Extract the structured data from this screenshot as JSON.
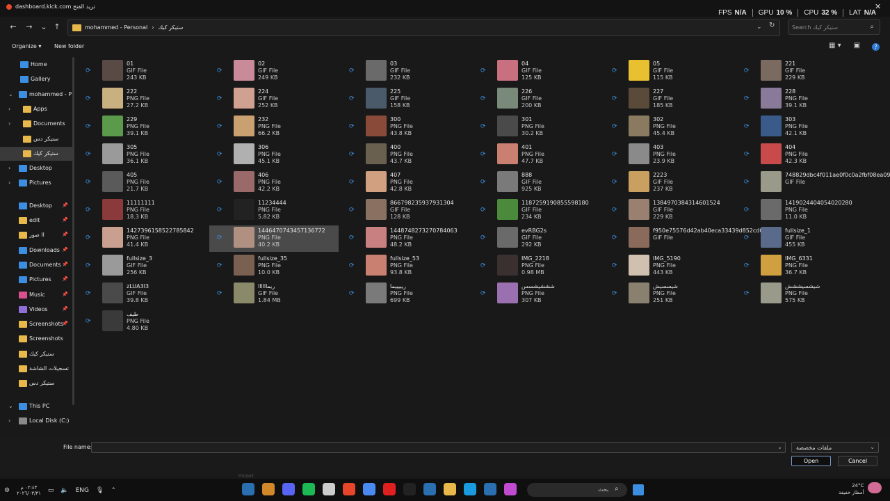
{
  "window": {
    "title": "dashboard.kick.com تريد الفتح",
    "close": "✕"
  },
  "overlay": {
    "items": [
      {
        "label": "FPS",
        "value": "N/A"
      },
      {
        "label": "GPU",
        "value": "10 %"
      },
      {
        "label": "CPU",
        "value": "32 %"
      },
      {
        "label": "LAT",
        "value": "N/A"
      }
    ]
  },
  "nav": {
    "back": "←",
    "forward": "→",
    "recent": "⌄",
    "up": "↑",
    "path": [
      "mohammed - Personal",
      "›",
      "ستيكر كيك"
    ],
    "refresh": "↻",
    "search_placeholder": "Search ستيكر كيك",
    "search_icon": "search-icon"
  },
  "commandbar": {
    "organize": "Organize ▾",
    "new_folder": "New folder",
    "help": "?"
  },
  "sidebar": {
    "items": [
      {
        "label": "Home",
        "icon": "home-icon",
        "color": "#3c8fe0",
        "chev": false,
        "pin": false
      },
      {
        "label": "Gallery",
        "icon": "gallery-icon",
        "color": "#3c8fe0",
        "chev": false,
        "pin": false
      },
      {
        "label": "mohammed - P",
        "icon": "cloud-icon",
        "color": "#3c8fe0",
        "chev": true,
        "open": true,
        "pin": false
      },
      {
        "label": "Apps",
        "icon": "folder-icon",
        "color": "#e8b84a",
        "chev": true,
        "pin": false
      },
      {
        "label": "Documents",
        "icon": "folder-icon",
        "color": "#e8b84a",
        "chev": true,
        "pin": false
      },
      {
        "label": "ستيكر دس",
        "icon": "folder-icon",
        "color": "#e8b84a",
        "chev": false,
        "pin": false
      },
      {
        "label": "ستيكر كيك",
        "icon": "folder-icon",
        "color": "#e8b84a",
        "chev": false,
        "pin": false,
        "selected": true
      },
      {
        "label": "Desktop",
        "icon": "desktop-icon",
        "color": "#3c8fe0",
        "chev": true,
        "pin": false
      },
      {
        "label": "Pictures",
        "icon": "pictures-icon",
        "color": "#3c8fe0",
        "chev": true,
        "pin": false
      },
      {
        "label": "Desktop",
        "icon": "desktop-icon",
        "color": "#3c8fe0",
        "chev": false,
        "pin": true,
        "gap": true
      },
      {
        "label": "edit",
        "icon": "folder-icon",
        "color": "#e8b84a",
        "chev": false,
        "pin": true
      },
      {
        "label": "صور ll",
        "icon": "folder-icon",
        "color": "#e8b84a",
        "chev": false,
        "pin": true
      },
      {
        "label": "Downloads",
        "icon": "download-icon",
        "color": "#3c8fe0",
        "chev": false,
        "pin": true
      },
      {
        "label": "Documents",
        "icon": "documents-icon",
        "color": "#3c8fe0",
        "chev": false,
        "pin": true
      },
      {
        "label": "Pictures",
        "icon": "pictures-icon",
        "color": "#3c8fe0",
        "chev": false,
        "pin": true
      },
      {
        "label": "Music",
        "icon": "music-icon",
        "color": "#d8508e",
        "chev": false,
        "pin": true
      },
      {
        "label": "Videos",
        "icon": "videos-icon",
        "color": "#8e6fd8",
        "chev": false,
        "pin": true
      },
      {
        "label": "Screenshots",
        "icon": "folder-icon",
        "color": "#e8b84a",
        "chev": false,
        "pin": true
      },
      {
        "label": "Screenshots",
        "icon": "folder-icon",
        "color": "#e8b84a",
        "chev": false,
        "pin": false
      },
      {
        "label": "ستيكر كيك",
        "icon": "folder-icon",
        "color": "#e8b84a",
        "chev": false,
        "pin": false
      },
      {
        "label": "تسجيلات الشاشة",
        "icon": "folder-icon",
        "color": "#e8b84a",
        "chev": false,
        "pin": false
      },
      {
        "label": "ستيكر دس",
        "icon": "folder-icon",
        "color": "#e8b84a",
        "chev": false,
        "pin": false
      },
      {
        "label": "This PC",
        "icon": "pc-icon",
        "color": "#3c8fe0",
        "chev": true,
        "open": true,
        "pin": false,
        "gap": true
      },
      {
        "label": "Local Disk (C:)",
        "icon": "drive-icon",
        "color": "#8a8a8a",
        "chev": true,
        "pin": false
      }
    ]
  },
  "files": [
    {
      "name": "01",
      "type": "GIF File",
      "size": "243 KB",
      "color": "#5a4a45"
    },
    {
      "name": "02",
      "type": "GIF File",
      "size": "249 KB",
      "color": "#c98a9a"
    },
    {
      "name": "03",
      "type": "GIF File",
      "size": "232 KB",
      "color": "#6a6a6a"
    },
    {
      "name": "04",
      "type": "GIF File",
      "size": "125 KB",
      "color": "#c97080"
    },
    {
      "name": "05",
      "type": "GIF File",
      "size": "115 KB",
      "color": "#e8c030"
    },
    {
      "name": "221",
      "type": "GIF File",
      "size": "229 KB",
      "color": "#7a6a60"
    },
    {
      "name": "222",
      "type": "PNG File",
      "size": "27.2 KB",
      "color": "#c9b080"
    },
    {
      "name": "224",
      "type": "GIF File",
      "size": "252 KB",
      "color": "#d0a090"
    },
    {
      "name": "225",
      "type": "GIF File",
      "size": "158 KB",
      "color": "#4a5a6a"
    },
    {
      "name": "226",
      "type": "GIF File",
      "size": "200 KB",
      "color": "#7a8a7a"
    },
    {
      "name": "227",
      "type": "GIF File",
      "size": "185 KB",
      "color": "#5a4a3a"
    },
    {
      "name": "228",
      "type": "PNG File",
      "size": "39.1 KB",
      "color": "#8a7a9a"
    },
    {
      "name": "229",
      "type": "PNG File",
      "size": "39.1 KB",
      "color": "#5a9a4a"
    },
    {
      "name": "232",
      "type": "PNG File",
      "size": "66.2 KB",
      "color": "#c9a070"
    },
    {
      "name": "300",
      "type": "PNG File",
      "size": "43.8 KB",
      "color": "#8a4a3a"
    },
    {
      "name": "301",
      "type": "PNG File",
      "size": "30.2 KB",
      "color": "#4a4a4a"
    },
    {
      "name": "302",
      "type": "PNG File",
      "size": "45.4 KB",
      "color": "#8a7a60"
    },
    {
      "name": "303",
      "type": "PNG File",
      "size": "42.1 KB",
      "color": "#3a5a8a"
    },
    {
      "name": "305",
      "type": "PNG File",
      "size": "36.1 KB",
      "color": "#9a9a9a"
    },
    {
      "name": "306",
      "type": "PNG File",
      "size": "45.1 KB",
      "color": "#b0b0b0"
    },
    {
      "name": "400",
      "type": "PNG File",
      "size": "43.7 KB",
      "color": "#6a6050"
    },
    {
      "name": "401",
      "type": "PNG File",
      "size": "47.7 KB",
      "color": "#c98070"
    },
    {
      "name": "403",
      "type": "PNG File",
      "size": "23.9 KB",
      "color": "#8a8a8a"
    },
    {
      "name": "404",
      "type": "PNG File",
      "size": "42.3 KB",
      "color": "#c94a4a"
    },
    {
      "name": "405",
      "type": "PNG File",
      "size": "21.7 KB",
      "color": "#5a5a5a"
    },
    {
      "name": "406",
      "type": "PNG File",
      "size": "42.2 KB",
      "color": "#9a6a6a"
    },
    {
      "name": "407",
      "type": "PNG File",
      "size": "42.8 KB",
      "color": "#d0a080"
    },
    {
      "name": "888",
      "type": "GIF File",
      "size": "925 KB",
      "color": "#7a7a7a"
    },
    {
      "name": "2223",
      "type": "GIF File",
      "size": "237 KB",
      "color": "#c9a060"
    },
    {
      "name": "748829dbc4f011ae0f0c0a2fbf08ea09",
      "type": "GIF File",
      "size": "",
      "color": "#9a9a8a"
    },
    {
      "name": "11111111",
      "type": "PNG File",
      "size": "18.3 KB",
      "color": "#8a3a3a"
    },
    {
      "name": "11234444",
      "type": "PNG File",
      "size": "5.82 KB",
      "color": "#222222"
    },
    {
      "name": "866798235937931304",
      "type": "GIF File",
      "size": "128 KB",
      "color": "#8a7060"
    },
    {
      "name": "1187259190855598180",
      "type": "GIF File",
      "size": "234 KB",
      "color": "#4a8a3a"
    },
    {
      "name": "1384970384314601524",
      "type": "GIF File",
      "size": "229 KB",
      "color": "#9a8070"
    },
    {
      "name": "1419024404054020280",
      "type": "PNG File",
      "size": "11.0 KB",
      "color": "#6a6a6a"
    },
    {
      "name": "1427396158522785842",
      "type": "PNG File",
      "size": "41.4 KB",
      "color": "#c9a090"
    },
    {
      "name": "1446470743457136772",
      "type": "PNG File",
      "size": "40.2 KB",
      "color": "#b09080",
      "selected": true
    },
    {
      "name": "1448748273270784063",
      "type": "PNG File",
      "size": "48.2 KB",
      "color": "#c98080"
    },
    {
      "name": "evRBG2s",
      "type": "GIF File",
      "size": "292 KB",
      "color": "#6a6a6a"
    },
    {
      "name": "f950e75576d42ab40eca33439d852cd0",
      "type": "GIF File",
      "size": "",
      "color": "#8a6a5a"
    },
    {
      "name": "fullsize_1",
      "type": "GIF File",
      "size": "455 KB",
      "color": "#5a6a8a"
    },
    {
      "name": "fullsize_3",
      "type": "GIF File",
      "size": "256 KB",
      "color": "#9a9a9a"
    },
    {
      "name": "fullsize_35",
      "type": "PNG File",
      "size": "10.0 KB",
      "color": "#7a6050"
    },
    {
      "name": "fullsize_53",
      "type": "PNG File",
      "size": "93.8 KB",
      "color": "#c98070"
    },
    {
      "name": "IMG_2218",
      "type": "PNG File",
      "size": "0.98 MB",
      "color": "#3a3030"
    },
    {
      "name": "IMG_5190",
      "type": "PNG File",
      "size": "443 KB",
      "color": "#d0c0b0"
    },
    {
      "name": "IMG_6331",
      "type": "PNG File",
      "size": "36.7 KB",
      "color": "#d0a040"
    },
    {
      "name": "zLUA3I3",
      "type": "GIF File",
      "size": "39.8 KB",
      "color": "#4a4a4a"
    },
    {
      "name": "ريماااااا",
      "type": "GIF File",
      "size": "1.84 MB",
      "color": "#8a8a6a"
    },
    {
      "name": "ريييييما",
      "type": "PNG File",
      "size": "699 KB",
      "color": "#7a7a7a"
    },
    {
      "name": "شششيشسس",
      "type": "PNG File",
      "size": "307 KB",
      "color": "#9a70b0"
    },
    {
      "name": "شيسسيش",
      "type": "PNG File",
      "size": "251 KB",
      "color": "#8a8070"
    },
    {
      "name": "شيشسيششش",
      "type": "PNG File",
      "size": "575 KB",
      "color": "#9a9a8a"
    },
    {
      "name": "طيف",
      "type": "PNG File",
      "size": "4.80 KB",
      "color": "#3a3a3a"
    }
  ],
  "footer": {
    "file_name_label": "File name:",
    "file_name_value": "",
    "file_type": "ملفات مخصصة",
    "open": "Open",
    "cancel": "Cancel"
  },
  "taskbar": {
    "clock_time": "٠٢:٤٣ م",
    "clock_date": "٢٠٢٦/٠٣/٣١",
    "lang": "ENG",
    "search_placeholder": "بحث",
    "weather_temp": "24°C",
    "weather_text": "أمطار خفيفة",
    "watermark": "mcoxt",
    "apps": [
      "#2a6fb0",
      "#d0882a",
      "#5865f2",
      "#1db954",
      "#cccccc",
      "#e8462a",
      "#4a8af0",
      "#e02020",
      "#222222",
      "#2a6fb0",
      "#e8b84a",
      "#1a9be0",
      "#2a6fb0",
      "#c04ad0"
    ]
  }
}
